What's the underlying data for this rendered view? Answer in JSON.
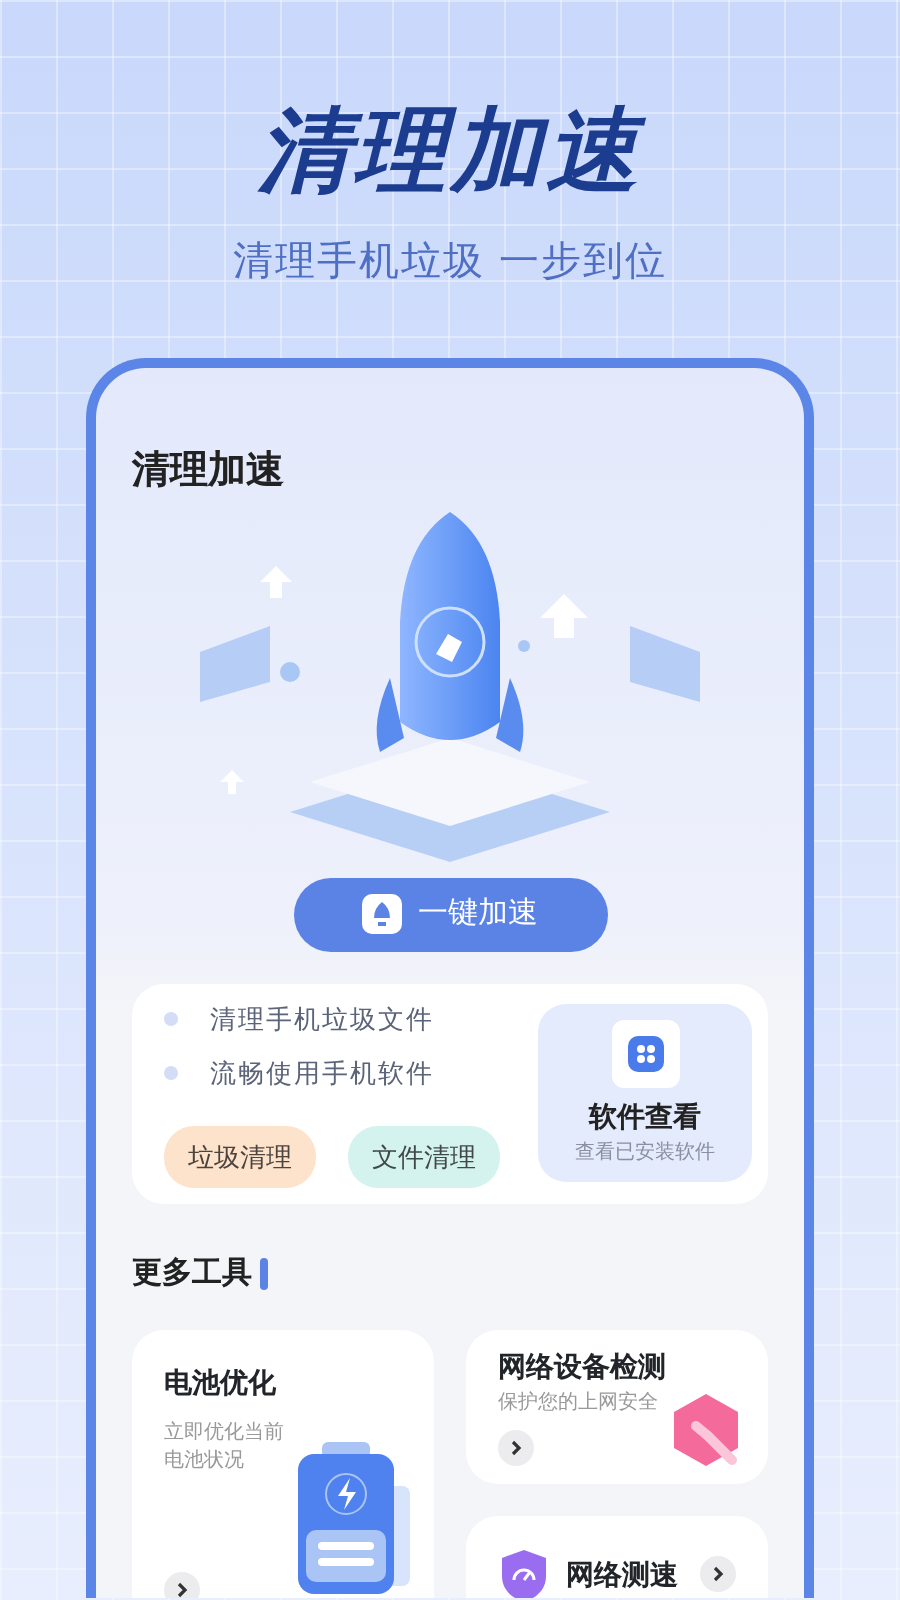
{
  "header": {
    "title": "清理加速",
    "subtitle": "清理手机垃圾 一步到位"
  },
  "screen": {
    "title": "清理加速",
    "boost_button": "一键加速",
    "features": [
      "清理手机垃圾文件",
      "流畅使用手机软件"
    ],
    "chips": [
      {
        "label": "垃圾清理",
        "color": "#fde3cc"
      },
      {
        "label": "文件清理",
        "color": "#d4f3ee"
      }
    ],
    "apps_tile": {
      "title": "软件查看",
      "subtitle": "查看已安装软件"
    },
    "section_title": "更多工具",
    "tools": [
      {
        "kind": "tall",
        "title": "电池优化",
        "subtitle": "立即优化当前电池状况"
      },
      {
        "kind": "wide",
        "title": "网络设备检测",
        "subtitle": "保护您的上网安全"
      },
      {
        "kind": "compact",
        "title": "网络测速"
      }
    ]
  }
}
